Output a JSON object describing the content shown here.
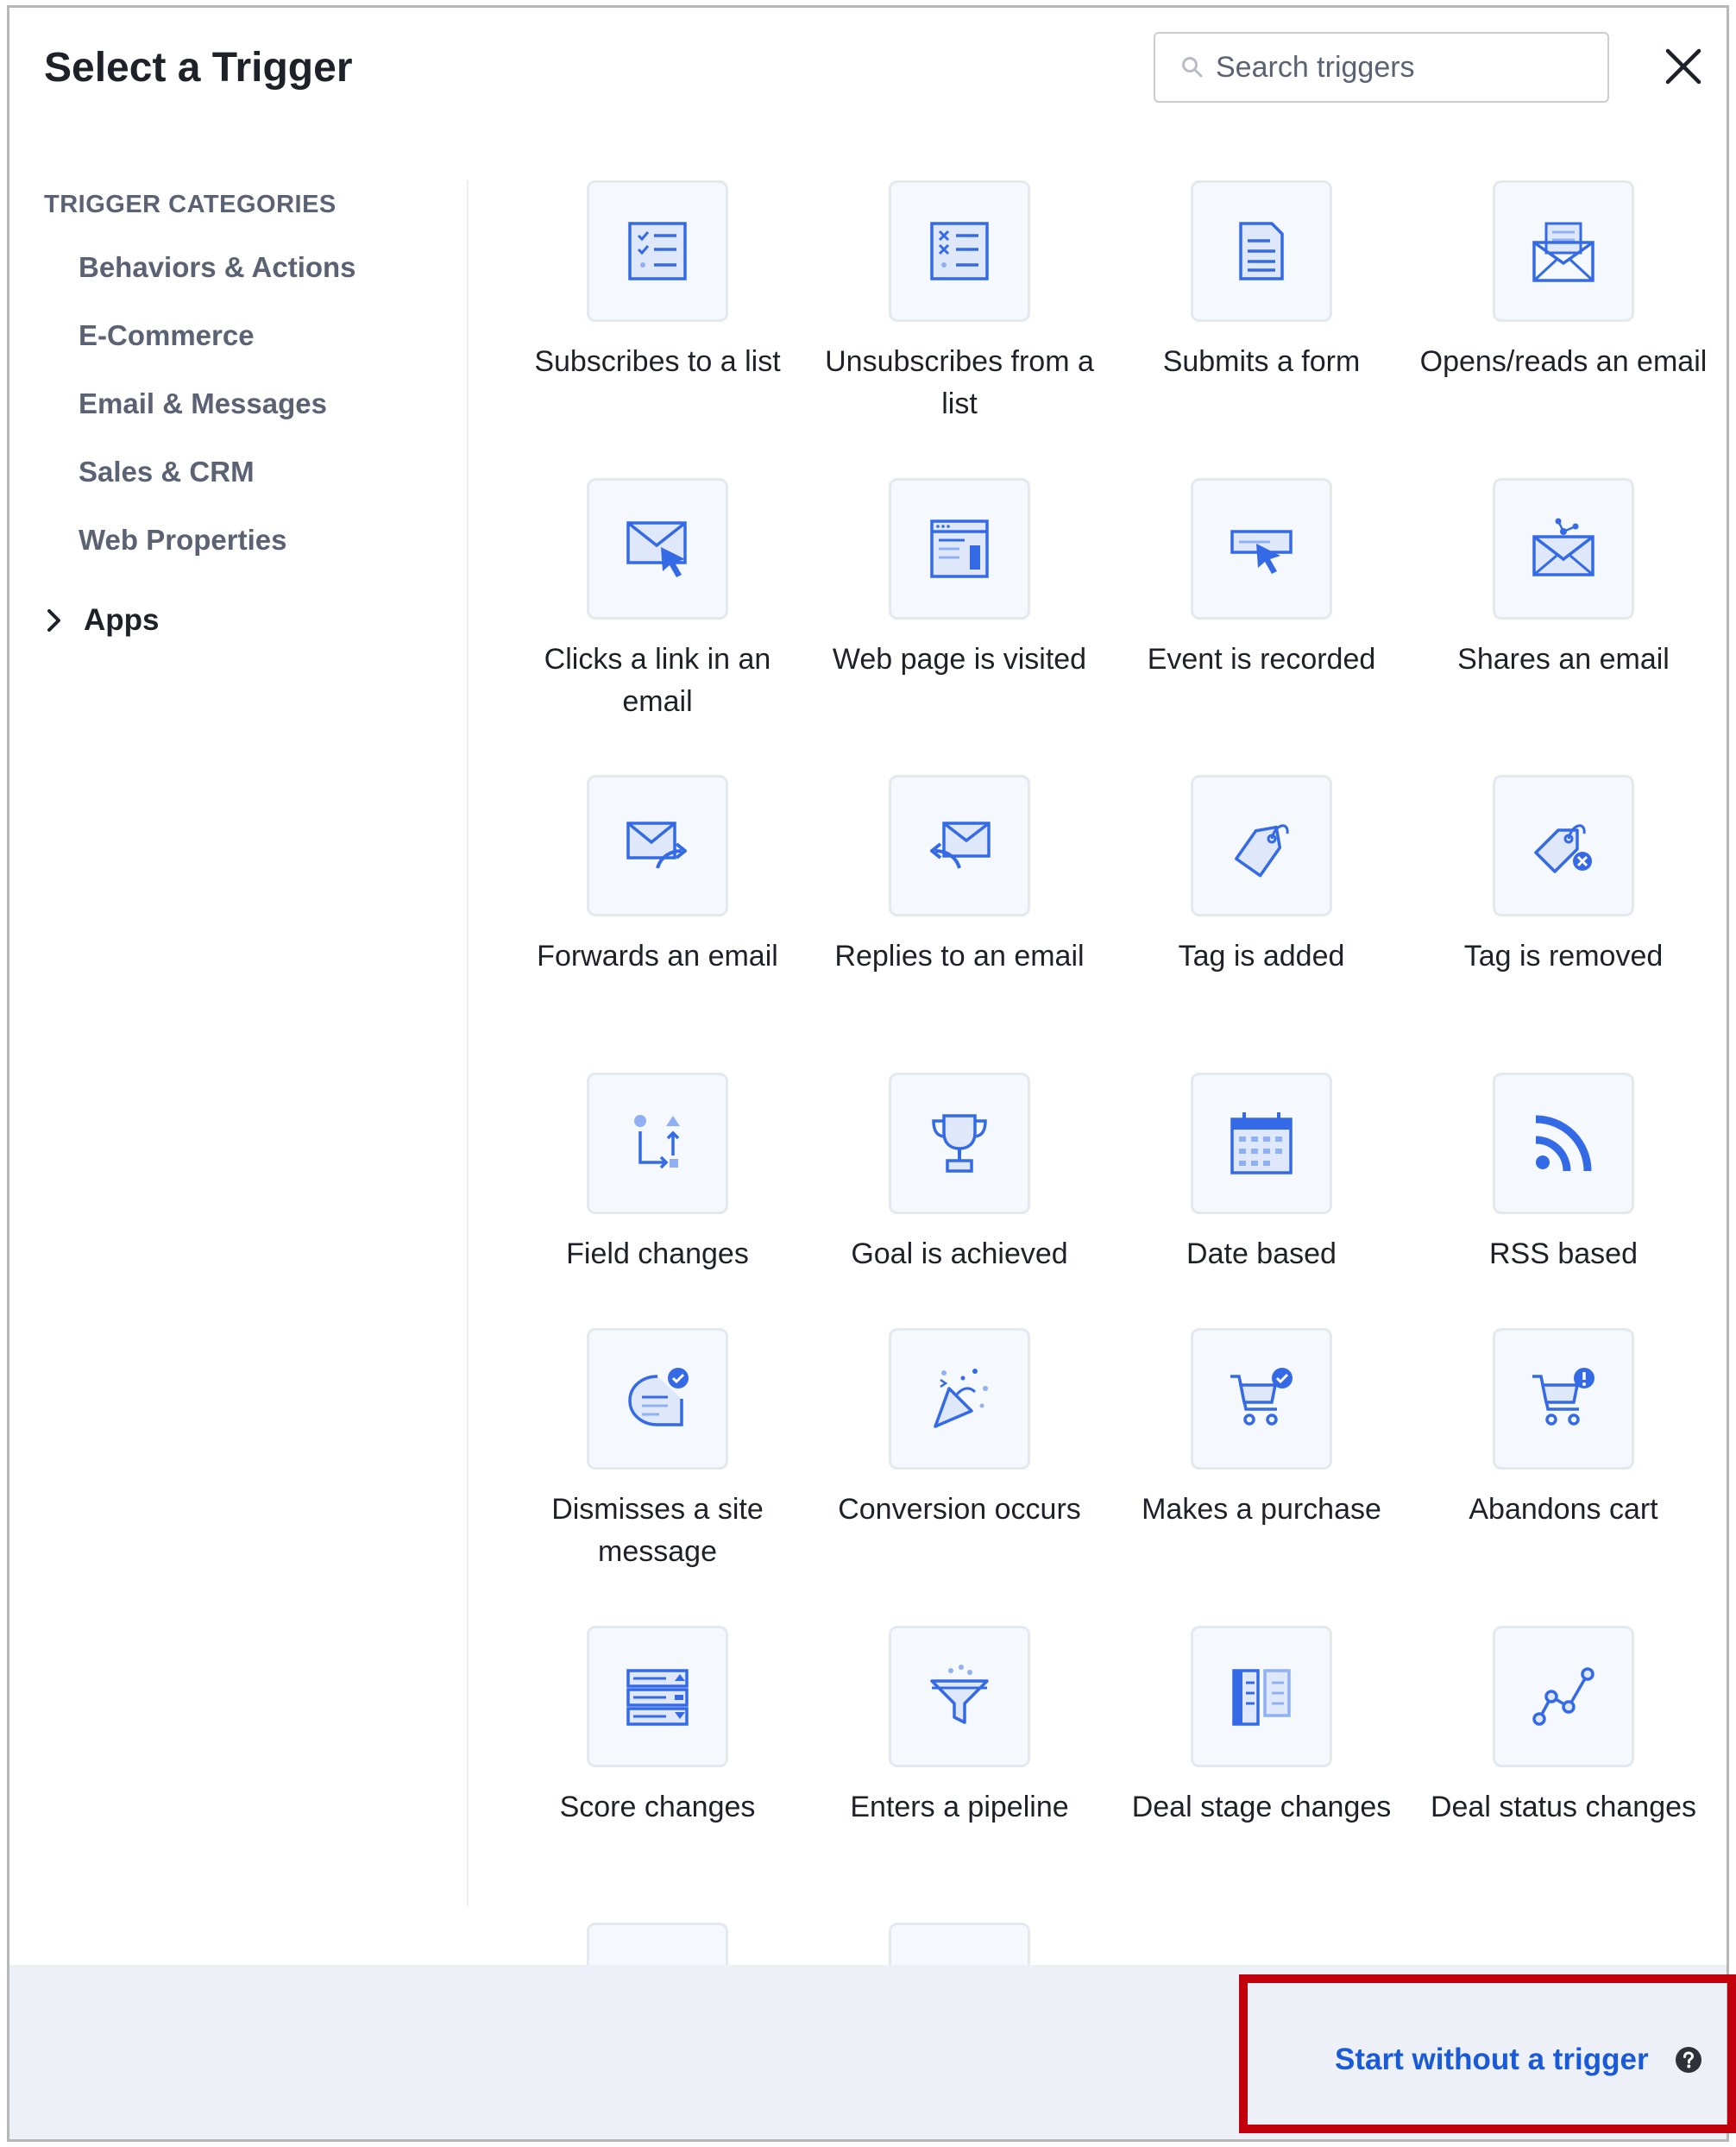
{
  "header": {
    "title": "Select a Trigger",
    "search_placeholder": "Search triggers"
  },
  "sidebar": {
    "heading": "TRIGGER CATEGORIES",
    "items": [
      "Behaviors & Actions",
      "E-Commerce",
      "Email & Messages",
      "Sales & CRM",
      "Web Properties"
    ],
    "apps_label": "Apps"
  },
  "triggers": [
    {
      "label": "Subscribes to a list",
      "icon": "checklist-icon"
    },
    {
      "label": "Unsubscribes from a list",
      "icon": "unsubscribe-list-icon"
    },
    {
      "label": "Submits a form",
      "icon": "form-icon"
    },
    {
      "label": "Opens/reads an email",
      "icon": "open-envelope-icon"
    },
    {
      "label": "Clicks a link in an email",
      "icon": "envelope-cursor-icon"
    },
    {
      "label": "Web page is visited",
      "icon": "web-page-icon"
    },
    {
      "label": "Event is recorded",
      "icon": "event-cursor-icon"
    },
    {
      "label": "Shares an email",
      "icon": "share-envelope-icon"
    },
    {
      "label": "Forwards an email",
      "icon": "forward-envelope-icon"
    },
    {
      "label": "Replies to an email",
      "icon": "reply-envelope-icon"
    },
    {
      "label": "Tag is added",
      "icon": "tag-icon"
    },
    {
      "label": "Tag is removed",
      "icon": "tag-remove-icon"
    },
    {
      "label": "Field changes",
      "icon": "field-change-icon"
    },
    {
      "label": "Goal is achieved",
      "icon": "trophy-icon"
    },
    {
      "label": "Date based",
      "icon": "calendar-icon"
    },
    {
      "label": "RSS based",
      "icon": "rss-icon"
    },
    {
      "label": "Dismisses a site message",
      "icon": "site-message-icon"
    },
    {
      "label": "Conversion occurs",
      "icon": "party-popper-icon"
    },
    {
      "label": "Makes a purchase",
      "icon": "cart-check-icon"
    },
    {
      "label": "Abandons cart",
      "icon": "cart-alert-icon"
    },
    {
      "label": "Score changes",
      "icon": "score-bars-icon"
    },
    {
      "label": "Enters a pipeline",
      "icon": "funnel-icon"
    },
    {
      "label": "Deal stage changes",
      "icon": "deal-stage-icon"
    },
    {
      "label": "Deal status changes",
      "icon": "line-chart-icon"
    }
  ],
  "footer": {
    "start_label": "Start without a trigger"
  },
  "colors": {
    "accent": "#356ae6",
    "highlight": "#c1000c"
  }
}
